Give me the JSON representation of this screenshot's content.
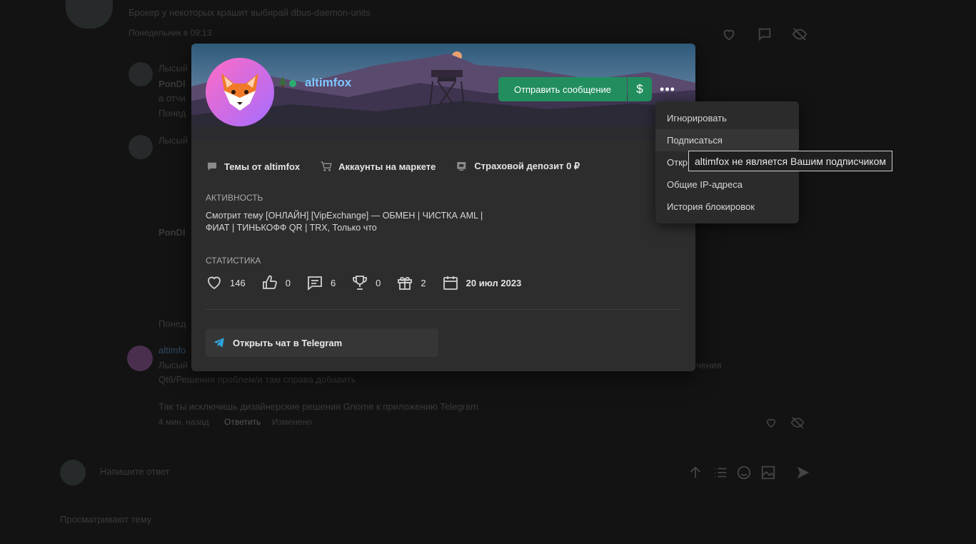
{
  "background": {
    "post1_text": "Брокер у некоторых крашит выбирай dbus-daemon-units",
    "post1_time": "Понедельник в 09:13",
    "user_partial_1": "Лысый",
    "user_partial_2": "PonDl",
    "text_partial_1": "а отчи",
    "time_partial_1": "Понед",
    "user_partial_3": "Лысый",
    "user_partial_4": "PonDl",
    "time_partial_2": "Понед",
    "reply_user": "altimfo",
    "reply_quote": "Лысый",
    "reply_quote_tail": "чения",
    "reply_line1": "Qt6/Решения проблем/и там справа добавить",
    "reply_line2": "Так ты исключишь дизайнерские решения Gnome к приложению Telegram",
    "reply_time": "4 мин. назад",
    "reply_action": "Ответить",
    "reply_edited": "Изменено",
    "reply_placeholder": "Напишите ответ",
    "viewing": "Просматривают тему"
  },
  "profile": {
    "username": "altimfox",
    "username_color": "#7fc6ff",
    "online_color": "#2bad72",
    "send_message": "Отправить сообщение",
    "donate_symbol": "$",
    "more_symbol": "•••",
    "links": [
      {
        "icon": "chat-bubble-icon",
        "label": "Темы от altimfox"
      },
      {
        "icon": "cart-icon",
        "label": "Аккаунты на маркете"
      },
      {
        "icon": "deposit-icon",
        "label": "Страховой депозит 0 ₽"
      }
    ],
    "activity_title": "Активность",
    "activity_text": "Смотрит тему [ОНЛАЙН] [VipExchange] — ОБМЕН | ЧИСТКА AML | ФИАТ | ТИНЬКОФФ QR | TRX, Только что",
    "stats_title": "Статистика",
    "stats": [
      {
        "icon": "heart-icon",
        "value": "146"
      },
      {
        "icon": "thumbs-up-icon",
        "value": "0"
      },
      {
        "icon": "comment-icon",
        "value": "6"
      },
      {
        "icon": "trophy-icon",
        "value": "0"
      },
      {
        "icon": "gift-icon",
        "value": "2"
      },
      {
        "icon": "calendar-icon",
        "value": "20 июл 2023"
      }
    ],
    "telegram_button": "Открыть чат в Telegram",
    "accent_color": "#228e5d"
  },
  "menu": {
    "items": [
      "Игнорировать",
      "Подписаться",
      "Откр",
      "Общие IP-адреса",
      "История блокировок"
    ],
    "hovered_index": 1
  },
  "tooltip": "altimfox не является Вашим подписчиком"
}
